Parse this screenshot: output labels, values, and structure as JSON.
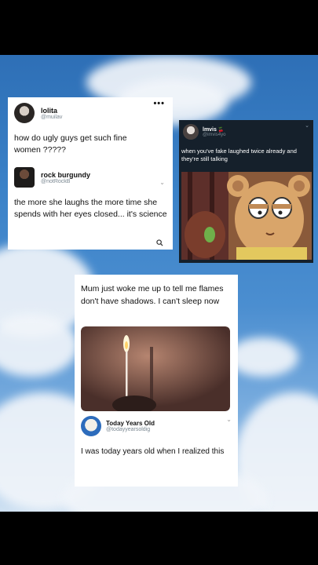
{
  "tweet1": {
    "user_name": "lolita",
    "user_handle": "@muilav",
    "more_label": "•••",
    "text": "how do ugly guys get such fine women ?????",
    "reply_name": "rock burgundy",
    "reply_handle": "@notRockB",
    "reply_text": "the more she laughs the more time she spends with her eyes closed...  it's science"
  },
  "tweet2": {
    "user_name": "lmvis",
    "user_badge": "🍒",
    "user_handle": "@imvis4yo",
    "text": "when you've fake laughed twice already and they're still talking"
  },
  "tweet3": {
    "text": "Mum just woke me up to tell me flames don't have shadows. I can't sleep now",
    "reply_name": "Today Years Old",
    "reply_handle": "@todayyearsoldig",
    "reply_text": "I was today years old when I realized this"
  },
  "icons": {
    "more": "more-dots-icon",
    "chevron": "chevron-down-icon",
    "link": "link-icon"
  },
  "colors": {
    "sky": "#3b82c8",
    "dark_card": "#15202b",
    "cloud": "#f1f5fa"
  }
}
